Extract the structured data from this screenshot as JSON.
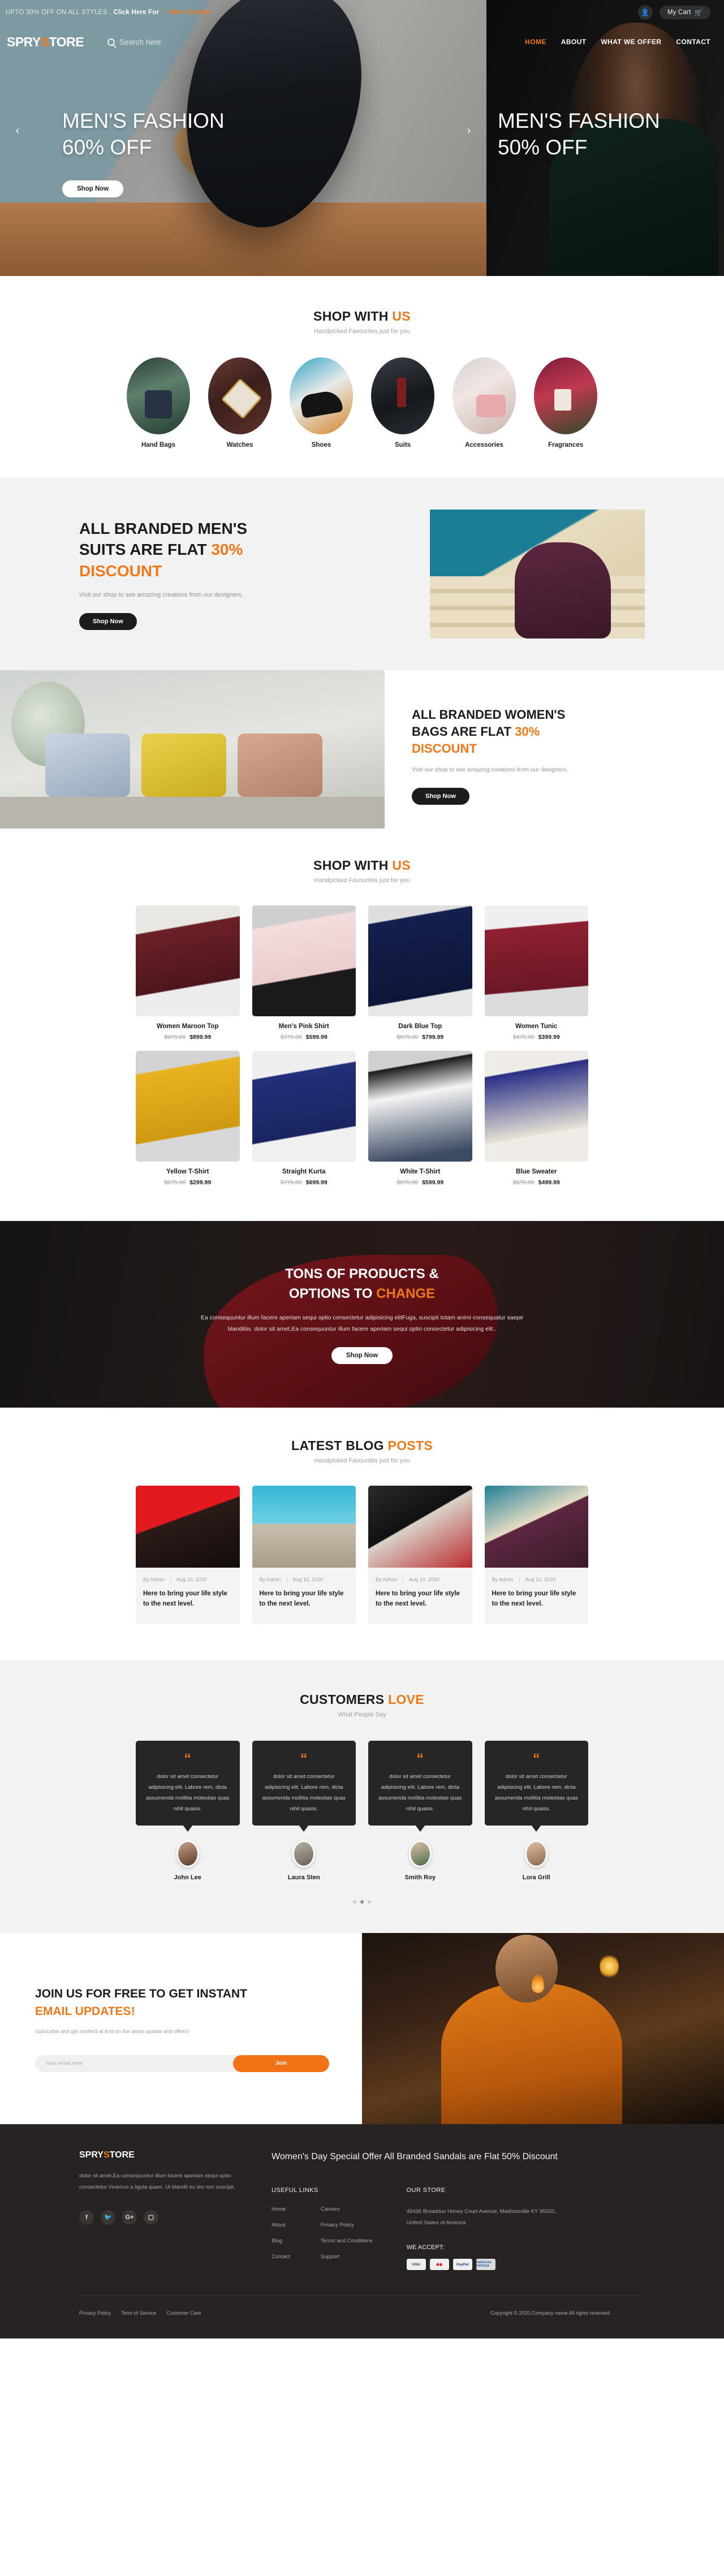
{
  "topbar": {
    "promo_text": "UPTO 30% OFF ON ALL STYLES ,",
    "promo_bold": "Click Here For",
    "hand_icon": "pointing-hand-icon",
    "more_link": "More Details",
    "user_icon": "user-icon",
    "cart_label": "My Cart",
    "cart_icon": "shopping-cart-icon"
  },
  "header": {
    "logo_pre": "SPRY",
    "logo_accent": "S",
    "logo_post": "TORE",
    "search_icon": "search-icon",
    "search_placeholder": "Search here",
    "search_value": "",
    "nav": [
      {
        "label": "HOME",
        "active": true
      },
      {
        "label": "ABOUT",
        "active": false
      },
      {
        "label": "WHAT WE OFFER",
        "active": false
      },
      {
        "label": "CONTACT",
        "active": false
      }
    ]
  },
  "hero": {
    "prev_icon": "chevron-left-icon",
    "next_icon": "chevron-right-icon",
    "slide_a": {
      "line1": "MEN'S FASHION",
      "line2": "60% OFF",
      "cta": "Shop Now"
    },
    "slide_b": {
      "line1": "MEN'S FASHION",
      "line2": "50% OFF"
    }
  },
  "categories_section": {
    "title_main": "SHOP WITH",
    "title_accent": "US",
    "subtitle": "Handpicked Favourites just for you",
    "items": [
      {
        "label": "Hand Bags"
      },
      {
        "label": "Watches"
      },
      {
        "label": "Shoes"
      },
      {
        "label": "Suits"
      },
      {
        "label": "Accessories"
      },
      {
        "label": "Fragrances"
      }
    ]
  },
  "banner_men": {
    "heading_1": "ALL BRANDED MEN'S",
    "heading_2": "SUITS ARE FLAT",
    "heading_accent": "30%",
    "heading_accent_2": "DISCOUNT",
    "description": "Visit our shop to see amazing creations from our designers.",
    "cta": "Shop Now"
  },
  "banner_women": {
    "heading_1": "ALL BRANDED WOMEN'S",
    "heading_2": "BAGS ARE FLAT",
    "heading_accent": "30%",
    "heading_accent_2": "DISCOUNT",
    "description": "Visit our shop to see amazing creations from our designers.",
    "cta": "Shop Now"
  },
  "products_section": {
    "title_main": "SHOP WITH",
    "title_accent": "US",
    "subtitle": "Handpicked Favourites just for you",
    "items": [
      {
        "name": "Women Maroon Top",
        "old_price": "$975.00",
        "new_price": "$899.99"
      },
      {
        "name": "Men's Pink Shirt",
        "old_price": "$775.00",
        "new_price": "$599.99"
      },
      {
        "name": "Dark Blue Top",
        "old_price": "$875.00",
        "new_price": "$799.99"
      },
      {
        "name": "Women Tunic",
        "old_price": "$475.00",
        "new_price": "$399.99"
      },
      {
        "name": "Yellow T-Shirt",
        "old_price": "$575.00",
        "new_price": "$299.99"
      },
      {
        "name": "Straight Kurta",
        "old_price": "$775.00",
        "new_price": "$699.99"
      },
      {
        "name": "White T-Shirt",
        "old_price": "$675.00",
        "new_price": "$599.99"
      },
      {
        "name": "Blue Sweater",
        "old_price": "$575.00",
        "new_price": "$499.99"
      }
    ]
  },
  "parallax": {
    "heading_1": "TONS OF PRODUCTS &",
    "heading_2": "OPTIONS TO",
    "heading_accent": "CHANGE",
    "description": "Ea consequuntur illum facere aperiam sequi optio consectetur adipisicing elitFuga, suscipit totam animi consequatur saepe blanditiis. dolor sit amet,Ea consequuntur illum facere aperiam sequi optio consectetur adipisicing elit..",
    "cta": "Shop Now"
  },
  "blog_section": {
    "title_main": "LATEST BLOG",
    "title_accent": "POSTS",
    "subtitle": "Handpicked Favourites just for you",
    "posts": [
      {
        "author": "By Admin",
        "date": "Aug 10, 2020",
        "title": "Here to bring your life style to the next level."
      },
      {
        "author": "By Admin",
        "date": "Aug 10, 2020",
        "title": "Here to bring your life style to the next level."
      },
      {
        "author": "By Admin",
        "date": "Aug 10, 2020",
        "title": "Here to bring your life style to the next level."
      },
      {
        "author": "By Admin",
        "date": "Aug 10, 2020",
        "title": "Here to bring your life style to the next level."
      }
    ]
  },
  "testimonials_section": {
    "title_main": "CUSTOMERS",
    "title_accent": "LOVE",
    "subtitle": "What People Say",
    "quote_icon": "quote-icon",
    "items": [
      {
        "text": "dolor sit amet consectetur adipisicing elit. Labore rem, dicta assumenda mollitia molestias quas nihil quasis.",
        "name": "John Lee"
      },
      {
        "text": "dolor sit amet consectetur adipisicing elit. Labore rem, dicta assumenda mollitia molestias quas nihil quasis.",
        "name": "Laura Sten"
      },
      {
        "text": "dolor sit amet consectetur adipisicing elit. Labore rem, dicta assumenda mollitia molestias quas nihil quasis.",
        "name": "Smith Roy"
      },
      {
        "text": "dolor sit amet consectetur adipisicing elit. Labore rem, dicta assumenda mollitia molestias quas nihil quasis.",
        "name": "Lora Grill"
      }
    ],
    "dots": 3,
    "active_dot": 1
  },
  "newsletter": {
    "heading_1": "JOIN US FOR FREE TO GET INSTANT",
    "heading_accent": "EMAIL UPDATES!",
    "description": "Subscribe and get notified at first on the latest update and offers!",
    "input_placeholder": "Your email here",
    "input_value": "",
    "button_label": "Join"
  },
  "footer": {
    "logo_pre": "SPRY",
    "logo_accent": "S",
    "logo_post": "TORE",
    "about": "dolor sit amet,Ea consequuntur illum facere aperiam sequi optio consectetur.Vivamus a ligula quam. Ut blandit eu leo non suscipit.",
    "social": [
      {
        "icon": "facebook-icon",
        "glyph": "f"
      },
      {
        "icon": "twitter-icon",
        "glyph": "ᴠ"
      },
      {
        "icon": "google-plus-icon",
        "glyph": "G+"
      },
      {
        "icon": "instagram-icon",
        "glyph": "□"
      }
    ],
    "headline": "Women's Day Special Offer All Branded Sandals are Flat 50% Discount",
    "useful_links_title": "USEFUL LINKS",
    "useful_links_col1": [
      "Home",
      "About",
      "Blog",
      "Contact"
    ],
    "useful_links_col2": [
      "Careers",
      "Privacy Policy",
      "Terms and Conditions",
      "Support"
    ],
    "store_title": "OUR STORE",
    "store_address": "49436 Broaddus Honey Court Avenue, Madisonville KY 95020, United States of America",
    "accept_title": "WE ACCEPT:",
    "cards": [
      "VISA",
      "MC",
      "PayPal",
      "AMERICAN EXPRESS"
    ],
    "bottom_links": [
      "Privacy Policy",
      "Term of Service",
      "Customer Care"
    ],
    "copyright": "Copyright © 2020.Company name All rights reserved."
  },
  "colors": {
    "accent": "#f07818",
    "dark": "#262322",
    "light_gray": "#f2f2f2"
  }
}
